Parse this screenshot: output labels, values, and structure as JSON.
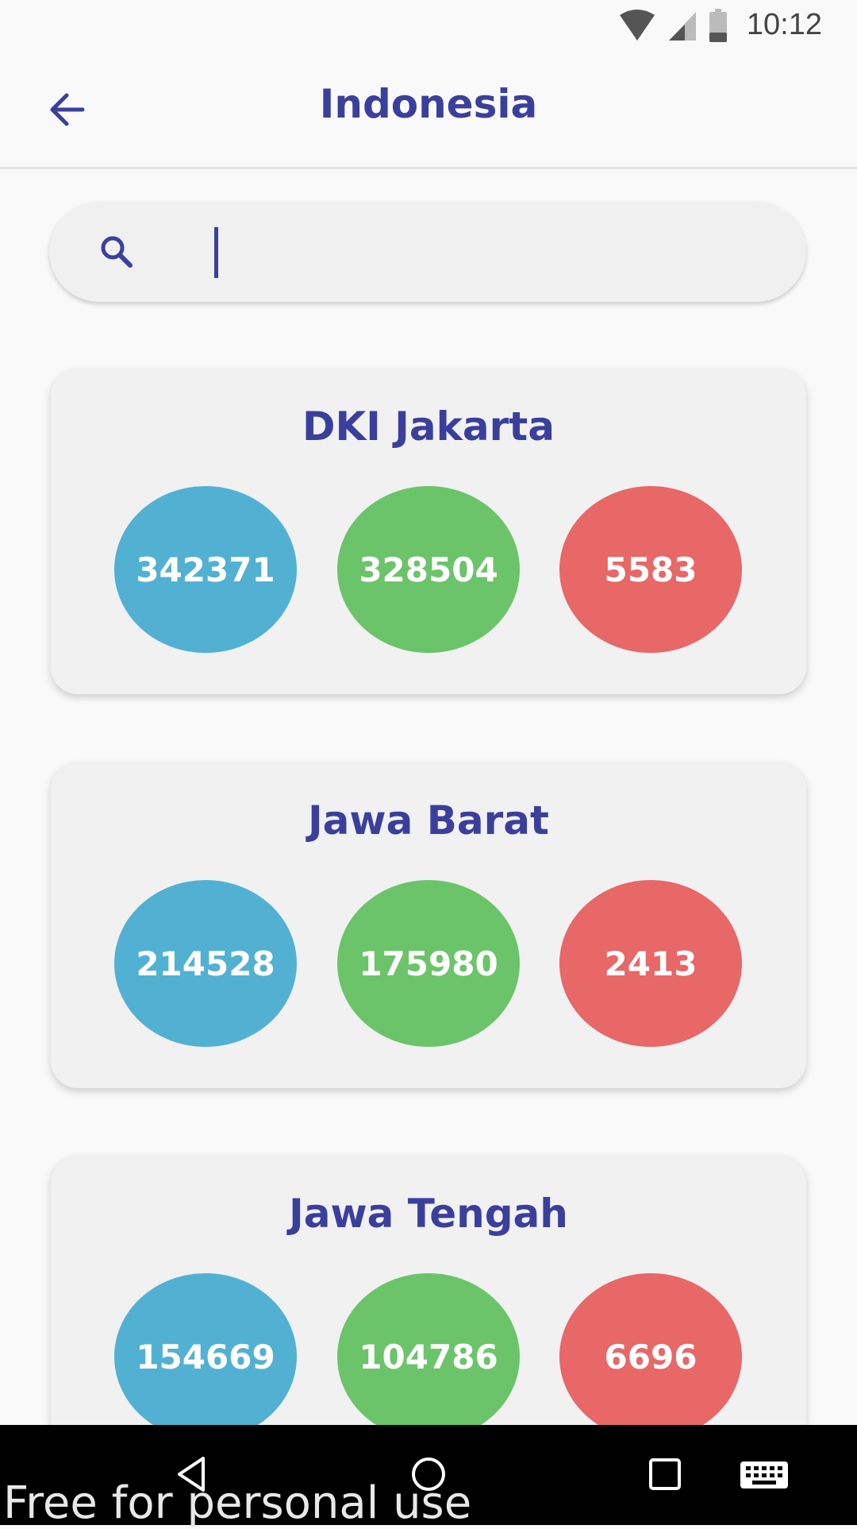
{
  "status_bar": {
    "time": "10:12"
  },
  "app_bar": {
    "title": "Indonesia"
  },
  "search": {
    "value": "",
    "placeholder": ""
  },
  "provinces": [
    {
      "name": "DKI Jakarta",
      "confirmed": "342371",
      "recovered": "328504",
      "deaths": "5583"
    },
    {
      "name": "Jawa Barat",
      "confirmed": "214528",
      "recovered": "175980",
      "deaths": "2413"
    },
    {
      "name": "Jawa Tengah",
      "confirmed": "154669",
      "recovered": "104786",
      "deaths": "6696"
    }
  ],
  "colors": {
    "accent": "#3b3f9c",
    "confirmed": "#52b1d2",
    "recovered": "#6cc46a",
    "deaths": "#e86767"
  },
  "icons": [
    "wifi-icon",
    "cell-signal-icon",
    "battery-icon",
    "back-arrow-icon",
    "search-icon",
    "nav-back-icon",
    "nav-home-icon",
    "nav-recents-icon",
    "keyboard-icon"
  ],
  "watermark": "Free for personal use"
}
